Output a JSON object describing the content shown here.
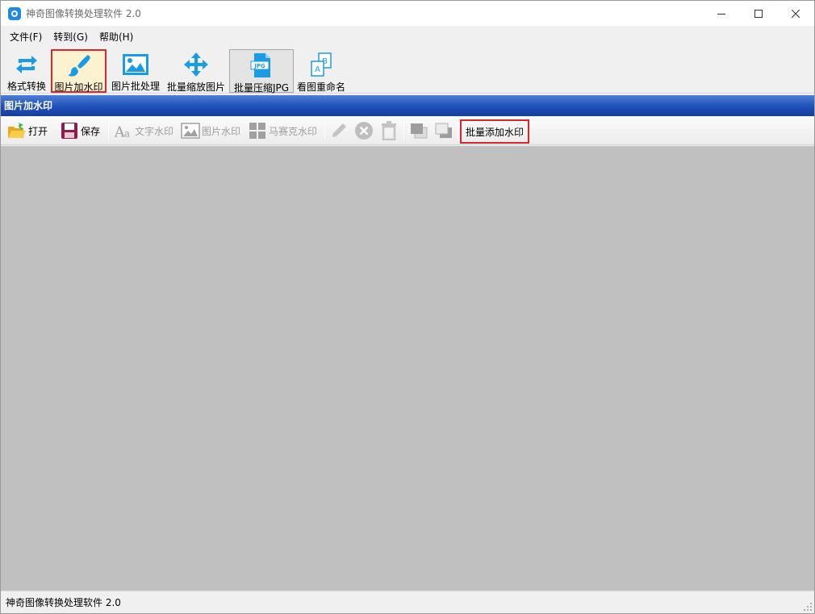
{
  "window": {
    "title": "神奇图像转换处理软件 2.0",
    "controls": {
      "minimize": "minimize-icon",
      "maximize": "maximize-icon",
      "close": "close-icon"
    }
  },
  "menu": {
    "items": [
      {
        "label": "文件(F)"
      },
      {
        "label": "转到(G)"
      },
      {
        "label": "帮助(H)"
      }
    ]
  },
  "main_toolbar": {
    "items": [
      {
        "label": "格式转换",
        "icon": "convert-arrows-icon"
      },
      {
        "label": "图片加水印",
        "icon": "brush-icon",
        "state": "selected"
      },
      {
        "label": "图片批处理",
        "icon": "image-icon"
      },
      {
        "label": "批量缩放图片",
        "icon": "move-arrows-icon"
      },
      {
        "label": "批量压缩JPG",
        "icon": "jpg-file-icon",
        "state": "pressed"
      },
      {
        "label": "看图重命名",
        "icon": "rename-ab-icon"
      }
    ]
  },
  "panel": {
    "title": "图片加水印"
  },
  "sub_toolbar": {
    "open": "打开",
    "save": "保存",
    "text_watermark": "文字水印",
    "image_watermark": "图片水印",
    "mosaic_watermark": "马赛克水印",
    "batch_watermark": "批量添加水印"
  },
  "colors": {
    "accent_red": "#e0262b",
    "header_blue": "#1f4fb8",
    "canvas_gray": "#c0c0c0",
    "icon_blue": "#1a9be6"
  },
  "status": {
    "text": "神奇图像转换处理软件 2.0"
  }
}
